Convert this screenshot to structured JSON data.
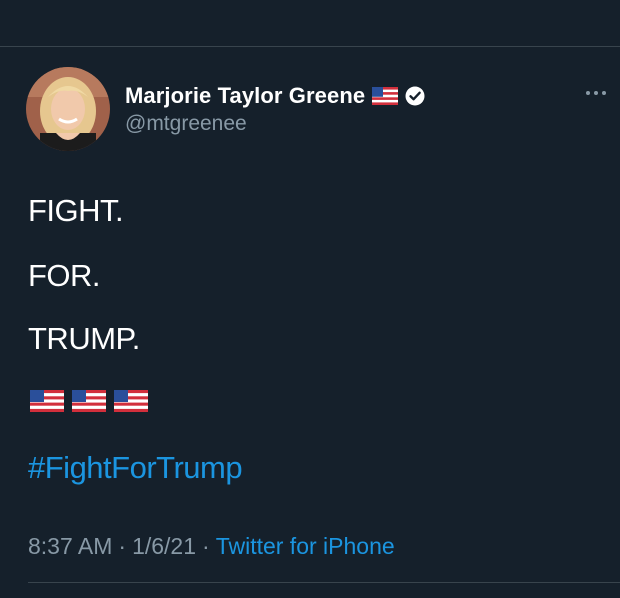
{
  "tweet": {
    "author": {
      "display_name": "Marjorie Taylor Greene",
      "name_emoji": "us-flag",
      "verified_icon": "verified-badge-icon",
      "handle": "@mtgreenee"
    },
    "more_icon": "more-options-icon",
    "lines": [
      "FIGHT.",
      "FOR.",
      "TRUMP."
    ],
    "emoji_row": [
      "us-flag",
      "us-flag",
      "us-flag"
    ],
    "hashtag": "#FightForTrump",
    "time": "8:37 AM",
    "separator1": "·",
    "date": "1/6/21",
    "separator2": "·",
    "source": "Twitter for iPhone"
  },
  "colors": {
    "background": "#15202b",
    "text": "#ffffff",
    "secondary_text": "#8899a6",
    "link": "#1b95e0",
    "divider": "#38444d"
  }
}
